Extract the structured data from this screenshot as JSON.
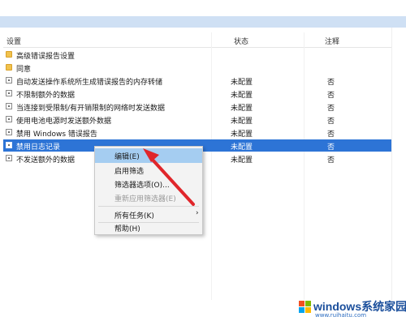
{
  "header": {
    "col_setting": "设置",
    "col_status": "状态",
    "col_note": "注释"
  },
  "rows": [
    {
      "icon": "folder-icon",
      "name": "高级错误报告设置",
      "status": "",
      "note": ""
    },
    {
      "icon": "folder-icon",
      "name": "同意",
      "status": "",
      "note": ""
    },
    {
      "icon": "setting-page-icon",
      "name": "自动发送操作系统所生成错误报告的内存转储",
      "status": "未配置",
      "note": "否"
    },
    {
      "icon": "setting-page-icon",
      "name": "不限制额外的数据",
      "status": "未配置",
      "note": "否"
    },
    {
      "icon": "setting-page-icon",
      "name": "当连接到受限制/有开销限制的网络时发送数据",
      "status": "未配置",
      "note": "否"
    },
    {
      "icon": "setting-page-icon",
      "name": "使用电池电源时发送额外数据",
      "status": "未配置",
      "note": "否"
    },
    {
      "icon": "setting-page-icon",
      "name": "禁用 Windows 错误报告",
      "status": "未配置",
      "note": "否"
    },
    {
      "icon": "setting-page-icon",
      "name": "禁用日志记录",
      "status": "未配置",
      "note": "否"
    },
    {
      "icon": "setting-page-icon",
      "name": "不发送额外的数据",
      "status": "未配置",
      "note": "否"
    }
  ],
  "context_menu": {
    "edit": "编辑(E)",
    "enable_filter": "启用筛选",
    "filter_options": "筛选器选项(O)...",
    "reapply_filter": "重新应用筛选器(E)",
    "all_tasks": "所有任务(K)",
    "help": "帮助(H)"
  },
  "watermark": {
    "text": "windows系统家园",
    "sub": "www.ruihaitu.com"
  },
  "colors": {
    "selection": "#2d74d6",
    "menu_highlight": "#a5cdf1",
    "arrow": "#e0262b"
  }
}
